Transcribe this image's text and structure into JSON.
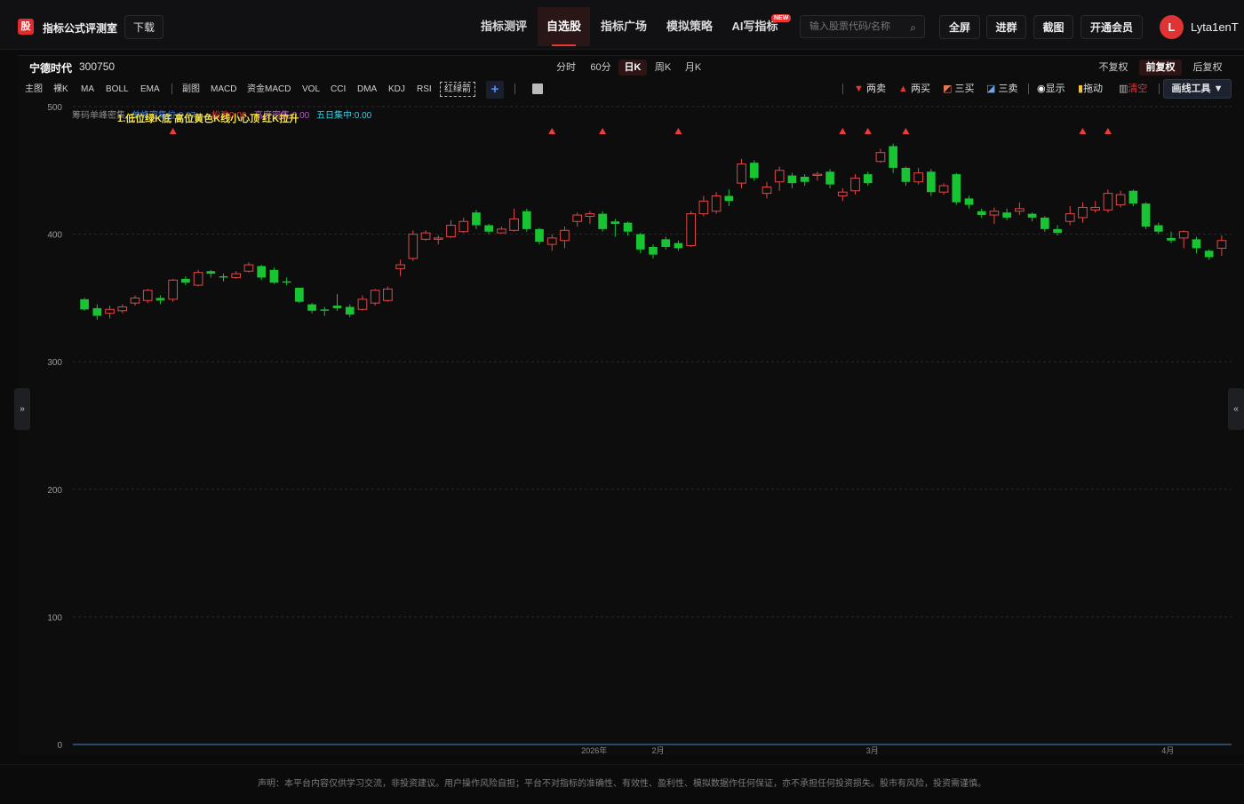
{
  "app": {
    "logo_char": "股",
    "name": "指标公式评测室",
    "download_label": "下载"
  },
  "nav": [
    {
      "label": "指标测评"
    },
    {
      "label": "自选股"
    },
    {
      "label": "指标广场"
    },
    {
      "label": "模拟策略"
    },
    {
      "label": "AI写指标"
    }
  ],
  "nav_badge": "NEW",
  "search": {
    "placeholder": "输入股票代码/名称"
  },
  "toolbar": {
    "fullscreen": "全屏",
    "join_group": "进群",
    "screenshot": "截图",
    "vip": "开通会员"
  },
  "user": {
    "avatar_letter": "L",
    "name": "Lyta1enT"
  },
  "stock": {
    "name": "宁德时代",
    "code": "300750"
  },
  "periods": [
    "分时",
    "60分",
    "日K",
    "周K",
    "月K"
  ],
  "active_period": "日K",
  "adjust": [
    "不复权",
    "前复权",
    "后复权"
  ],
  "active_adjust": "前复权",
  "indicators": [
    "主图",
    "裸K",
    "MA",
    "BOLL",
    "EMA",
    "副图",
    "MACD",
    "资金MACD",
    "VOL",
    "CCI",
    "DMA",
    "KDJ",
    "RSI"
  ],
  "active_indicator": "红绿箭",
  "signal_tools": [
    {
      "label": "两卖",
      "color": "#e53535"
    },
    {
      "label": "两买",
      "color": "#e53535"
    },
    {
      "label": "三买",
      "color": "#dddddd"
    },
    {
      "label": "三卖",
      "color": "#dddddd"
    },
    {
      "label": "显示",
      "color": "#dddddd"
    },
    {
      "label": "拖动",
      "color": "#dddddd"
    },
    {
      "label": "清空",
      "color": "#e53535"
    }
  ],
  "draw_tools_label": "画线工具 ▼",
  "legend": {
    "chip": "筹码单峰密集",
    "chip_sub": "单峰密集位:0.17",
    "loose": "松弛0.00",
    "dense": "高度密集:0.00",
    "five_day": "五日集中:0.00",
    "headline": "1.低位绿K底 高位黄色K线小心顶 红K拉升"
  },
  "chart_data": {
    "type": "candlestick",
    "ylim": [
      0,
      500
    ],
    "yticks": [
      500,
      400,
      300,
      200,
      100,
      0
    ],
    "xticks": [
      "2026年",
      "2月",
      "3月",
      "4月"
    ],
    "candles": [
      [
        349,
        341,
        350,
        340
      ],
      [
        342,
        336,
        345,
        333
      ],
      [
        338,
        341,
        344,
        334
      ],
      [
        340,
        343,
        345,
        338
      ],
      [
        346,
        350,
        352,
        344
      ],
      [
        348,
        356,
        357,
        346
      ],
      [
        350,
        348,
        352,
        345
      ],
      [
        349,
        364,
        365,
        347
      ],
      [
        365,
        362,
        367,
        360
      ],
      [
        360,
        370,
        372,
        359
      ],
      [
        371,
        369,
        372,
        366
      ],
      [
        367,
        366,
        369,
        363
      ],
      [
        366,
        369,
        371,
        365
      ],
      [
        371,
        376,
        378,
        370
      ],
      [
        375,
        366,
        376,
        364
      ],
      [
        372,
        362,
        374,
        361
      ],
      [
        363,
        362,
        366,
        360
      ],
      [
        358,
        347,
        358,
        346
      ],
      [
        345,
        340,
        346,
        338
      ],
      [
        341,
        340,
        343,
        336
      ],
      [
        344,
        342,
        353,
        340
      ],
      [
        343,
        337,
        345,
        335
      ],
      [
        341,
        349,
        352,
        340
      ],
      [
        346,
        356,
        357,
        344
      ],
      [
        348,
        357,
        359,
        347
      ],
      [
        373,
        376,
        380,
        367
      ],
      [
        381,
        400,
        403,
        379
      ],
      [
        396,
        401,
        403,
        395
      ],
      [
        396,
        397,
        399,
        392
      ],
      [
        398,
        407,
        411,
        397
      ],
      [
        402,
        410,
        413,
        401
      ],
      [
        417,
        407,
        419,
        404
      ],
      [
        407,
        402,
        408,
        400
      ],
      [
        401,
        404,
        406,
        401
      ],
      [
        403,
        412,
        420,
        402
      ],
      [
        418,
        404,
        420,
        402
      ],
      [
        404,
        394,
        405,
        392
      ],
      [
        392,
        397,
        400,
        387
      ],
      [
        395,
        403,
        406,
        389
      ],
      [
        410,
        415,
        417,
        406
      ],
      [
        414,
        416,
        418,
        408
      ],
      [
        416,
        404,
        418,
        402
      ],
      [
        410,
        408,
        412,
        398
      ],
      [
        409,
        402,
        410,
        399
      ],
      [
        400,
        388,
        401,
        385
      ],
      [
        390,
        384,
        392,
        381
      ],
      [
        396,
        390,
        398,
        388
      ],
      [
        393,
        389,
        395,
        387
      ],
      [
        391,
        416,
        418,
        390
      ],
      [
        416,
        426,
        430,
        414
      ],
      [
        418,
        430,
        433,
        416
      ],
      [
        430,
        426,
        435,
        422
      ],
      [
        440,
        455,
        459,
        436
      ],
      [
        456,
        444,
        458,
        442
      ],
      [
        432,
        437,
        441,
        428
      ],
      [
        441,
        450,
        453,
        434
      ],
      [
        446,
        440,
        448,
        436
      ],
      [
        445,
        441,
        447,
        438
      ],
      [
        446,
        447,
        449,
        442
      ],
      [
        449,
        439,
        451,
        436
      ],
      [
        430,
        433,
        436,
        426
      ],
      [
        434,
        444,
        447,
        431
      ],
      [
        447,
        440,
        449,
        438
      ],
      [
        457,
        464,
        467,
        456
      ],
      [
        469,
        452,
        471,
        448
      ],
      [
        452,
        441,
        453,
        438
      ],
      [
        441,
        448,
        452,
        439
      ],
      [
        449,
        433,
        451,
        430
      ],
      [
        433,
        438,
        440,
        431
      ],
      [
        447,
        425,
        448,
        423
      ],
      [
        428,
        423,
        430,
        420
      ],
      [
        418,
        415,
        420,
        413
      ],
      [
        415,
        418,
        421,
        408
      ],
      [
        417,
        413,
        420,
        411
      ],
      [
        418,
        420,
        425,
        415
      ],
      [
        416,
        413,
        417,
        410
      ],
      [
        413,
        404,
        414,
        402
      ],
      [
        404,
        401,
        407,
        399
      ],
      [
        410,
        416,
        422,
        407
      ],
      [
        413,
        421,
        425,
        409
      ],
      [
        419,
        421,
        426,
        417
      ],
      [
        419,
        432,
        435,
        417
      ],
      [
        423,
        431,
        434,
        421
      ],
      [
        434,
        424,
        435,
        422
      ],
      [
        424,
        406,
        425,
        404
      ],
      [
        407,
        402,
        409,
        400
      ],
      [
        397,
        395,
        402,
        393
      ],
      [
        397,
        402,
        403,
        389
      ],
      [
        396,
        389,
        398,
        385
      ],
      [
        387,
        382,
        388,
        380
      ],
      [
        389,
        395,
        399,
        383
      ]
    ],
    "signals": [
      7,
      37,
      41,
      47,
      60,
      62,
      65,
      79,
      81
    ]
  },
  "disclaimer": "声明：本平台内容仅供学习交流，非投资建议。用户操作风险自担；平台不对指标的准确性、有效性、盈利性、模拟数据作任何保证，亦不承担任何投资损失。股市有风险，投资需谨慎。"
}
